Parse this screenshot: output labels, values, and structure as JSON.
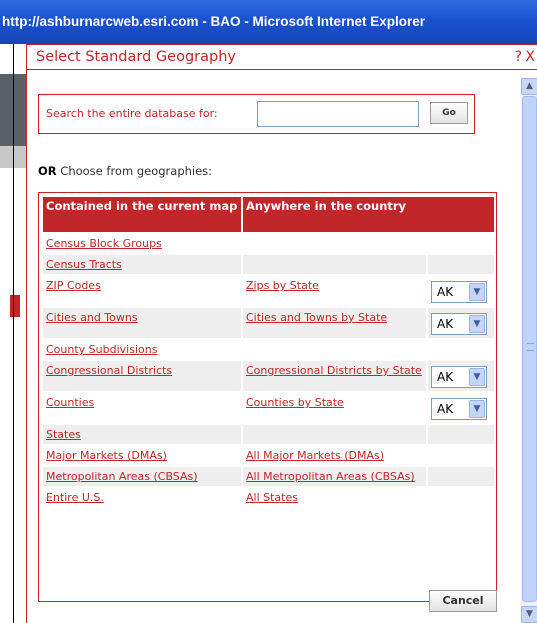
{
  "window": {
    "title": "http://ashburnarcweb.esri.com - BAO - Microsoft Internet Explorer"
  },
  "dialog": {
    "title": "Select Standard Geography",
    "help_label": "?",
    "close_label": "X"
  },
  "search": {
    "label": "Search the entire database for:",
    "value": "",
    "go_label": "Go"
  },
  "or_prefix": "OR",
  "or_text": "Choose from geographies:",
  "table": {
    "headers": [
      "Contained in the current map",
      "Anywhere in the country",
      ""
    ],
    "rows": [
      {
        "left": "Census Block Groups",
        "right": "",
        "state": ""
      },
      {
        "left": "Census Tracts",
        "right": "",
        "state": ""
      },
      {
        "left": "ZIP Codes",
        "right": "Zips by State",
        "state": "AK"
      },
      {
        "left": "Cities and Towns",
        "right": "Cities and Towns by State",
        "state": "AK"
      },
      {
        "left": "County Subdivisions",
        "right": "",
        "state": ""
      },
      {
        "left": "Congressional Districts",
        "right": "Congressional Districts by State",
        "state": "AK"
      },
      {
        "left": "Counties",
        "right": "Counties by State",
        "state": "AK"
      },
      {
        "left": "States",
        "right": "",
        "state": ""
      },
      {
        "left": "Major Markets (DMAs)",
        "right": "All Major Markets (DMAs)",
        "state": ""
      },
      {
        "left": "Metropolitan Areas (CBSAs)",
        "right": "All Metropolitan Areas (CBSAs)",
        "state": ""
      },
      {
        "left": "Entire U.S.",
        "right": "All States",
        "state": ""
      }
    ]
  },
  "cancel_label": "Cancel",
  "icons": {
    "scroll_up": "chevron-up-icon",
    "scroll_down": "chevron-down-icon",
    "dropdown": "chevron-down-icon"
  },
  "colors": {
    "accent": "#c0262a",
    "titlebar": "#1a52cf"
  }
}
